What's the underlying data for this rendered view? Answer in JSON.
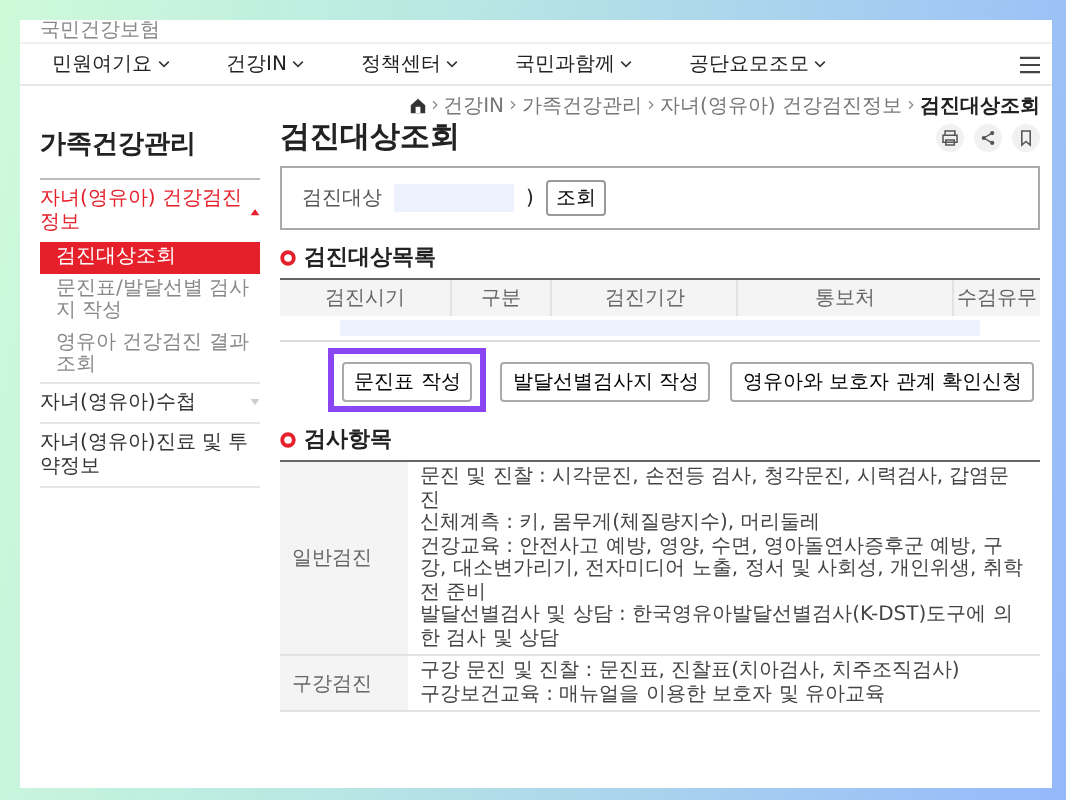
{
  "site": {
    "logo_text": "국민건강보험"
  },
  "nav": {
    "items": [
      {
        "label": "민원여기요"
      },
      {
        "label": "건강IN"
      },
      {
        "label": "정책센터"
      },
      {
        "label": "국민과함께"
      },
      {
        "label": "공단요모조모"
      }
    ]
  },
  "breadcrumb": [
    "건강IN",
    "가족건강관리",
    "자녀(영유아) 건강검진정보",
    "검진대상조회"
  ],
  "sidebar": {
    "title": "가족건강관리",
    "items": [
      {
        "label": "자녀(영유아) 건강검진정보",
        "expanded": true,
        "children": [
          {
            "label": "검진대상조회",
            "selected": true
          },
          {
            "label": "문진표/발달선별 검사지 작성",
            "selected": false
          },
          {
            "label": "영유아 건강검진 결과조회",
            "selected": false
          }
        ]
      },
      {
        "label": "자녀(영유아)수첩",
        "expanded": false
      },
      {
        "label": "자녀(영유아)진료 및 투약정보"
      }
    ]
  },
  "page": {
    "title": "검진대상조회"
  },
  "search": {
    "label": "검진대상",
    "suffix": ")",
    "button": "조회"
  },
  "target_list": {
    "heading": "검진대상목록",
    "columns": [
      "검진시기",
      "구분",
      "검진기간",
      "통보처",
      "수검유무"
    ]
  },
  "actions": [
    {
      "label": "문진표 작성",
      "highlighted": true
    },
    {
      "label": "발달선별검사지 작성",
      "highlighted": false
    },
    {
      "label": "영유아와 보호자 관계 확인신청",
      "highlighted": false
    }
  ],
  "exam_items": {
    "heading": "검사항목",
    "rows": [
      {
        "category": "일반검진",
        "lines": [
          "문진 및 진찰 : 시각문진, 손전등 검사, 청각문진, 시력검사, 갑염문진",
          "신체계측 : 키, 몸무게(체질량지수), 머리둘레",
          "건강교육 : 안전사고 예방, 영양, 수면, 영아돌연사증후군 예방, 구강, 대소변가리기, 전자미디어 노출, 정서 및 사회성, 개인위생, 취학전 준비",
          "발달선별검사 및 상담 : 한국영유아발달선별검사(K-DST)도구에 의한 검사 및 상담"
        ]
      },
      {
        "category": "구강검진",
        "lines": [
          "구강 문진 및 진찰 : 문진표, 진찰표(치아검사, 치주조직검사)",
          "구강보건교육 : 매뉴얼을 이용한 보호자 및 유아교육"
        ]
      }
    ]
  }
}
